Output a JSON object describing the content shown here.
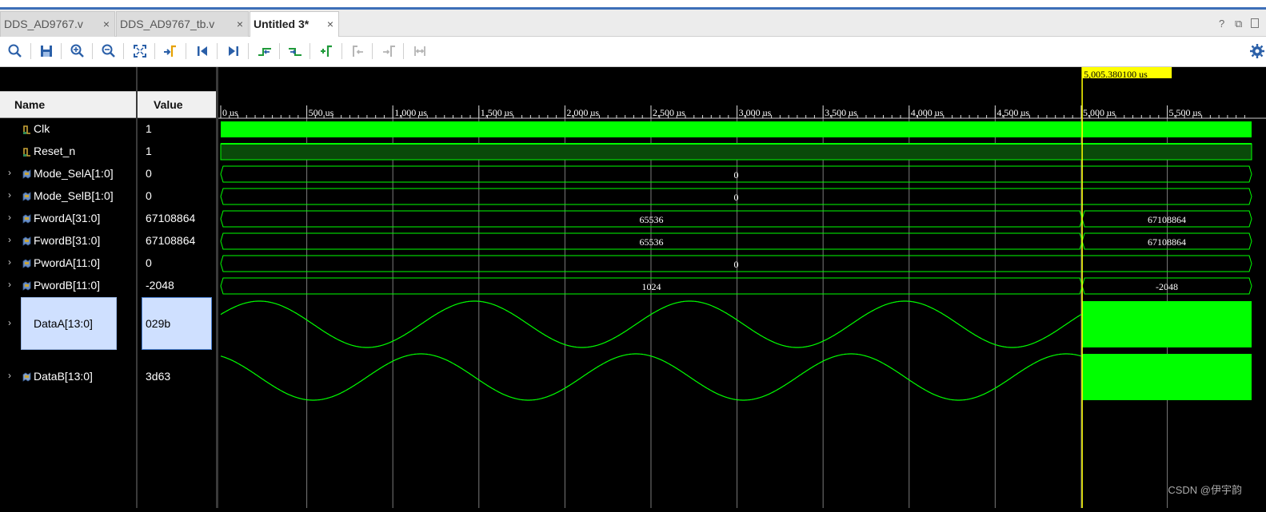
{
  "tabs": [
    {
      "label": "DDS_AD9767.v",
      "active": false
    },
    {
      "label": "DDS_AD9767_tb.v",
      "active": false
    },
    {
      "label": "Untitled 3*",
      "active": true
    }
  ],
  "tab_close_glyph": "×",
  "window_controls": {
    "help": "?",
    "restore": "⧉"
  },
  "toolbar_icons": [
    "search-icon",
    "save-icon",
    "zoom-in-icon",
    "zoom-out-icon",
    "zoom-fit-icon",
    "go-to-cursor-icon",
    "go-to-start-icon",
    "go-to-end-icon",
    "previous-transition-icon",
    "next-transition-icon",
    "add-marker-icon",
    "previous-marker-icon",
    "next-marker-icon",
    "swap-cursors-icon",
    "settings-icon"
  ],
  "columns": {
    "name": "Name",
    "value": "Value"
  },
  "signals": [
    {
      "name": "Clk",
      "value": "1",
      "kind": "bit",
      "expandable": false
    },
    {
      "name": "Reset_n",
      "value": "1",
      "kind": "bit",
      "expandable": false
    },
    {
      "name": "Mode_SelA[1:0]",
      "value": "0",
      "kind": "bus",
      "expandable": true
    },
    {
      "name": "Mode_SelB[1:0]",
      "value": "0",
      "kind": "bus",
      "expandable": true
    },
    {
      "name": "FwordA[31:0]",
      "value": "67108864",
      "kind": "bus",
      "expandable": true
    },
    {
      "name": "FwordB[31:0]",
      "value": "67108864",
      "kind": "bus",
      "expandable": true
    },
    {
      "name": "PwordA[11:0]",
      "value": "0",
      "kind": "bus",
      "expandable": true
    },
    {
      "name": "PwordB[11:0]",
      "value": "-2048",
      "kind": "bus",
      "expandable": true
    },
    {
      "name": "DataA[13:0]",
      "value": "029b",
      "kind": "analog",
      "expandable": true,
      "selected": true
    },
    {
      "name": "DataB[13:0]",
      "value": "3d63",
      "kind": "analog",
      "expandable": true
    }
  ],
  "timeline": {
    "unit": "us",
    "tick_labels": [
      "0 us",
      "500 us",
      "1,000 us",
      "1,500 us",
      "2,000 us",
      "2,500 us",
      "3,000 us",
      "3,500 us",
      "4,000 us",
      "4,500 us",
      "5,000 us",
      "5,500 us"
    ],
    "tick_values": [
      0,
      500,
      1000,
      1500,
      2000,
      2500,
      3000,
      3500,
      4000,
      4500,
      5000,
      5500
    ],
    "range": [
      0,
      5990
    ],
    "cursor_value": 5005.3801,
    "cursor_label": "5,005.380100 us"
  },
  "bus_segments": {
    "Mode_SelA[1:0]": [
      {
        "from": 0,
        "to": 5990,
        "label": "0"
      }
    ],
    "Mode_SelB[1:0]": [
      {
        "from": 0,
        "to": 5990,
        "label": "0"
      }
    ],
    "FwordA[31:0]": [
      {
        "from": 0,
        "to": 5005.38,
        "label": "65536"
      },
      {
        "from": 5005.38,
        "to": 5990,
        "label": "67108864"
      }
    ],
    "FwordB[31:0]": [
      {
        "from": 0,
        "to": 5005.38,
        "label": "65536"
      },
      {
        "from": 5005.38,
        "to": 5990,
        "label": "67108864"
      }
    ],
    "PwordA[11:0]": [
      {
        "from": 0,
        "to": 5990,
        "label": "0"
      }
    ],
    "PwordB[11:0]": [
      {
        "from": 0,
        "to": 5005.38,
        "label": "1024"
      },
      {
        "from": 5005.38,
        "to": 5990,
        "label": "-2048"
      }
    ]
  },
  "analog": {
    "period_us": 1250,
    "switch_us": 5005.38,
    "phase_offset_B": 0.25
  },
  "colors": {
    "wave_green": "#00ff00",
    "reset_fill": "#0a4a0a",
    "cursor": "#ffff00",
    "grid": "#7a7a7a",
    "selection": "#cfe0ff"
  },
  "watermark": "CSDN @伊宇韵"
}
